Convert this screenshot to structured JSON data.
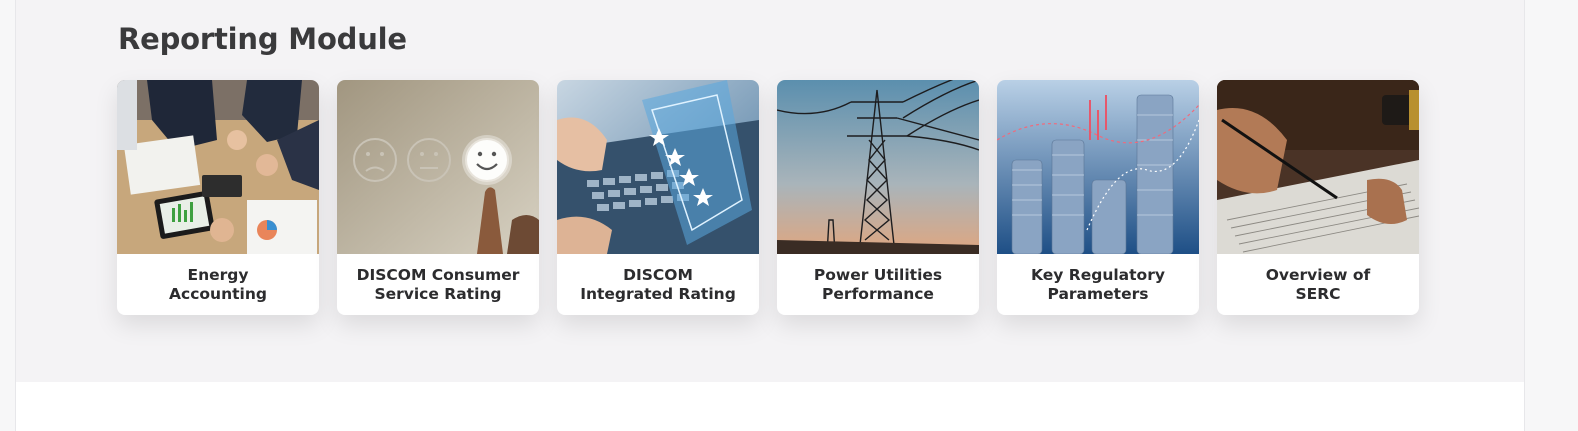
{
  "section": {
    "title": "Reporting Module"
  },
  "cards": [
    {
      "label": "Energy\nAccounting",
      "image": "business-meeting-charts-image"
    },
    {
      "label": "DISCOM Consumer\nService Rating",
      "image": "satisfaction-smiley-rating-image"
    },
    {
      "label": "DISCOM\nIntegrated Rating",
      "image": "laptop-star-rating-image"
    },
    {
      "label": "Power Utilities\nPerformance",
      "image": "transmission-tower-image"
    },
    {
      "label": "Key Regulatory\nParameters",
      "image": "coin-stacks-chart-image"
    },
    {
      "label": "Overview of\nSERC",
      "image": "signing-document-gavel-image"
    }
  ]
}
